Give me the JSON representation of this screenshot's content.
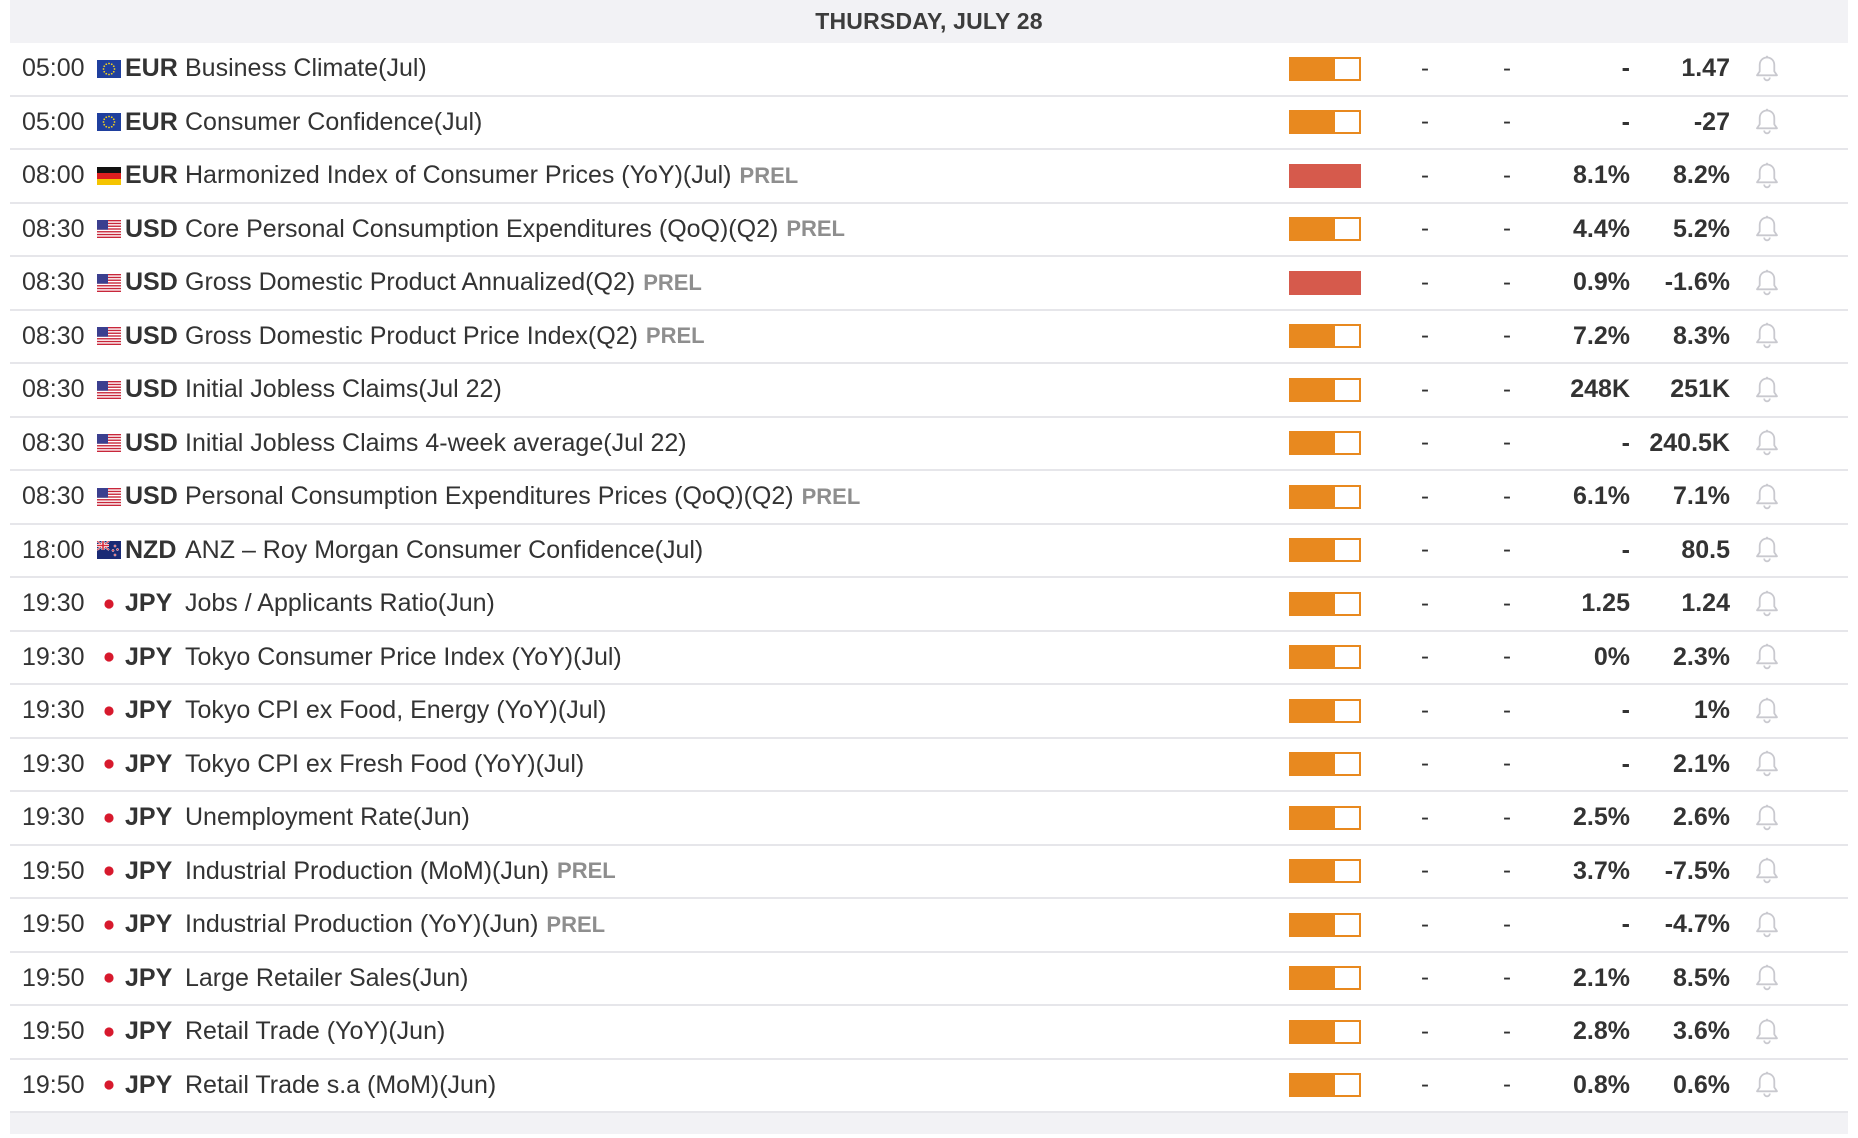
{
  "day_header": "THURSDAY, JULY 28",
  "colors": {
    "medium_impact": "#e8891f",
    "high_impact": "#d65a4c",
    "prel_text": "#8e8e8e"
  },
  "events": [
    {
      "time": "05:00",
      "flag": "eu-flag-icon",
      "currency": "EUR",
      "event": "Business Climate(Jul)",
      "prel": "",
      "impact": "medium",
      "actual": "-",
      "forecast": "-",
      "previous_consensus": "-",
      "previous": "1.47"
    },
    {
      "time": "05:00",
      "flag": "eu-flag-icon",
      "currency": "EUR",
      "event": "Consumer Confidence(Jul)",
      "prel": "",
      "impact": "medium",
      "actual": "-",
      "forecast": "-",
      "previous_consensus": "-",
      "previous": "-27"
    },
    {
      "time": "08:00",
      "flag": "germany-flag-icon",
      "currency": "EUR",
      "event": "Harmonized Index of Consumer Prices (YoY)(Jul)",
      "prel": "PREL",
      "impact": "high",
      "actual": "-",
      "forecast": "-",
      "previous_consensus": "8.1%",
      "previous": "8.2%"
    },
    {
      "time": "08:30",
      "flag": "us-flag-icon",
      "currency": "USD",
      "event": "Core Personal Consumption Expenditures (QoQ)(Q2)",
      "prel": "PREL",
      "impact": "medium",
      "actual": "-",
      "forecast": "-",
      "previous_consensus": "4.4%",
      "previous": "5.2%"
    },
    {
      "time": "08:30",
      "flag": "us-flag-icon",
      "currency": "USD",
      "event": "Gross Domestic Product Annualized(Q2)",
      "prel": "PREL",
      "impact": "high",
      "actual": "-",
      "forecast": "-",
      "previous_consensus": "0.9%",
      "previous": "-1.6%"
    },
    {
      "time": "08:30",
      "flag": "us-flag-icon",
      "currency": "USD",
      "event": "Gross Domestic Product Price Index(Q2)",
      "prel": "PREL",
      "impact": "medium",
      "actual": "-",
      "forecast": "-",
      "previous_consensus": "7.2%",
      "previous": "8.3%"
    },
    {
      "time": "08:30",
      "flag": "us-flag-icon",
      "currency": "USD",
      "event": "Initial Jobless Claims(Jul 22)",
      "prel": "",
      "impact": "medium",
      "actual": "-",
      "forecast": "-",
      "previous_consensus": "248K",
      "previous": "251K"
    },
    {
      "time": "08:30",
      "flag": "us-flag-icon",
      "currency": "USD",
      "event": "Initial Jobless Claims 4-week average(Jul 22)",
      "prel": "",
      "impact": "medium",
      "actual": "-",
      "forecast": "-",
      "previous_consensus": "-",
      "previous": "240.5K"
    },
    {
      "time": "08:30",
      "flag": "us-flag-icon",
      "currency": "USD",
      "event": "Personal Consumption Expenditures Prices (QoQ)(Q2)",
      "prel": "PREL",
      "impact": "medium",
      "actual": "-",
      "forecast": "-",
      "previous_consensus": "6.1%",
      "previous": "7.1%"
    },
    {
      "time": "18:00",
      "flag": "new-zealand-flag-icon",
      "currency": "NZD",
      "event": "ANZ – Roy Morgan Consumer Confidence(Jul)",
      "prel": "",
      "impact": "medium",
      "actual": "-",
      "forecast": "-",
      "previous_consensus": "-",
      "previous": "80.5"
    },
    {
      "time": "19:30",
      "flag": "japan-flag-icon",
      "currency": "JPY",
      "event": "Jobs / Applicants Ratio(Jun)",
      "prel": "",
      "impact": "medium",
      "actual": "-",
      "forecast": "-",
      "previous_consensus": "1.25",
      "previous": "1.24"
    },
    {
      "time": "19:30",
      "flag": "japan-flag-icon",
      "currency": "JPY",
      "event": "Tokyo Consumer Price Index (YoY)(Jul)",
      "prel": "",
      "impact": "medium",
      "actual": "-",
      "forecast": "-",
      "previous_consensus": "0%",
      "previous": "2.3%"
    },
    {
      "time": "19:30",
      "flag": "japan-flag-icon",
      "currency": "JPY",
      "event": "Tokyo CPI ex Food, Energy (YoY)(Jul)",
      "prel": "",
      "impact": "medium",
      "actual": "-",
      "forecast": "-",
      "previous_consensus": "-",
      "previous": "1%"
    },
    {
      "time": "19:30",
      "flag": "japan-flag-icon",
      "currency": "JPY",
      "event": "Tokyo CPI ex Fresh Food (YoY)(Jul)",
      "prel": "",
      "impact": "medium",
      "actual": "-",
      "forecast": "-",
      "previous_consensus": "-",
      "previous": "2.1%"
    },
    {
      "time": "19:30",
      "flag": "japan-flag-icon",
      "currency": "JPY",
      "event": "Unemployment Rate(Jun)",
      "prel": "",
      "impact": "medium",
      "actual": "-",
      "forecast": "-",
      "previous_consensus": "2.5%",
      "previous": "2.6%"
    },
    {
      "time": "19:50",
      "flag": "japan-flag-icon",
      "currency": "JPY",
      "event": "Industrial Production (MoM)(Jun)",
      "prel": "PREL",
      "impact": "medium",
      "actual": "-",
      "forecast": "-",
      "previous_consensus": "3.7%",
      "previous": "-7.5%"
    },
    {
      "time": "19:50",
      "flag": "japan-flag-icon",
      "currency": "JPY",
      "event": "Industrial Production (YoY)(Jun)",
      "prel": "PREL",
      "impact": "medium",
      "actual": "-",
      "forecast": "-",
      "previous_consensus": "-",
      "previous": "-4.7%"
    },
    {
      "time": "19:50",
      "flag": "japan-flag-icon",
      "currency": "JPY",
      "event": "Large Retailer Sales(Jun)",
      "prel": "",
      "impact": "medium",
      "actual": "-",
      "forecast": "-",
      "previous_consensus": "2.1%",
      "previous": "8.5%"
    },
    {
      "time": "19:50",
      "flag": "japan-flag-icon",
      "currency": "JPY",
      "event": "Retail Trade (YoY)(Jun)",
      "prel": "",
      "impact": "medium",
      "actual": "-",
      "forecast": "-",
      "previous_consensus": "2.8%",
      "previous": "3.6%"
    },
    {
      "time": "19:50",
      "flag": "japan-flag-icon",
      "currency": "JPY",
      "event": "Retail Trade s.a (MoM)(Jun)",
      "prel": "",
      "impact": "medium",
      "actual": "-",
      "forecast": "-",
      "previous_consensus": "0.8%",
      "previous": "0.6%"
    }
  ]
}
